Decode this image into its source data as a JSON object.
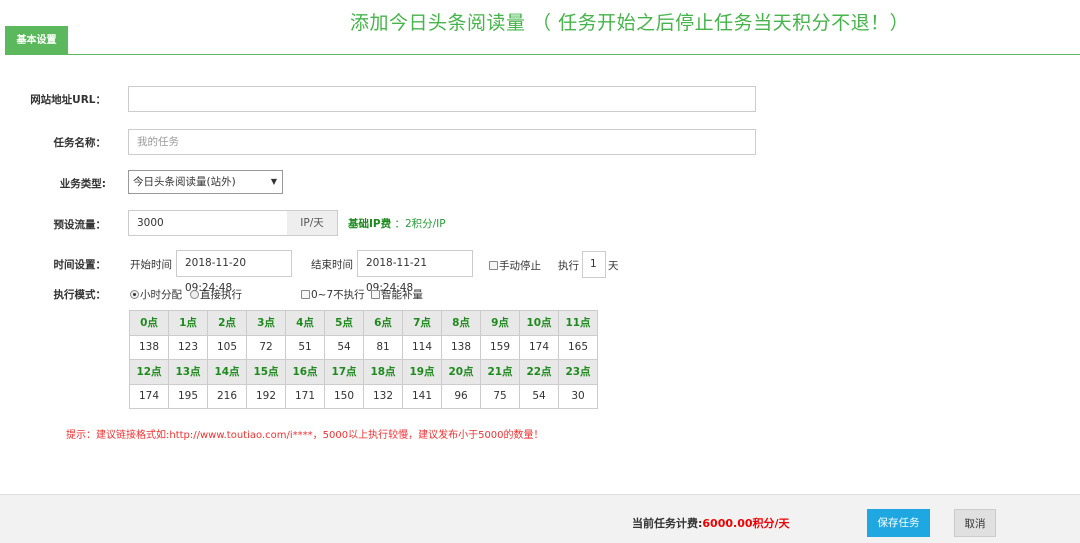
{
  "title": "添加今日头条阅读量 （ 任务开始之后停止任务当天积分不退！）",
  "tab": "基本设置",
  "form": {
    "url_label": "网站地址URL：",
    "url_value": "",
    "name_label": "任务名称：",
    "name_placeholder": "我的任务",
    "type_label": "业务类型:",
    "type_value": "今日头条阅读量(站外)",
    "traffic_label": "预设流量：",
    "traffic_value": "3000",
    "traffic_unit": "IP/天",
    "fee_label": "基础IP费",
    "fee_value": "：2积分/IP",
    "time_label": "时间设置：",
    "start_label": "开始时间",
    "start_value": "2018-11-20 09:24:48",
    "end_label": "结束时间",
    "end_value": "2018-11-21 09:24:48",
    "manual_stop": "手动停止",
    "exec_label": "执行",
    "exec_days": "1",
    "exec_unit": "天",
    "mode_label": "执行模式：",
    "mode_hourly": "小时分配",
    "mode_direct": "直接执行",
    "no_exec_0_7": "0~7不执行",
    "smart_fill": "智能补量"
  },
  "hours": {
    "row1_labels": [
      "0点",
      "1点",
      "2点",
      "3点",
      "4点",
      "5点",
      "6点",
      "7点",
      "8点",
      "9点",
      "10点",
      "11点"
    ],
    "row1_values": [
      "138",
      "123",
      "105",
      "72",
      "51",
      "54",
      "81",
      "114",
      "138",
      "159",
      "174",
      "165"
    ],
    "row2_labels": [
      "12点",
      "13点",
      "14点",
      "15点",
      "16点",
      "17点",
      "18点",
      "19点",
      "20点",
      "21点",
      "22点",
      "23点"
    ],
    "row2_values": [
      "174",
      "195",
      "216",
      "192",
      "171",
      "150",
      "132",
      "141",
      "96",
      "75",
      "54",
      "30"
    ]
  },
  "tip": "提示：建议链接格式如:http://www.toutiao.com/i****，5000以上执行较慢，建议发布小于5000的数量！",
  "footer": {
    "cost_label": "当前任务计费:",
    "cost_value": "6000.00积分/天",
    "save": "保存任务",
    "cancel": "取消"
  },
  "colors": {
    "accent_green": "#5cb85c",
    "title_green": "#46b34b",
    "save_blue": "#1ea7e0",
    "tip_red": "#e33"
  }
}
